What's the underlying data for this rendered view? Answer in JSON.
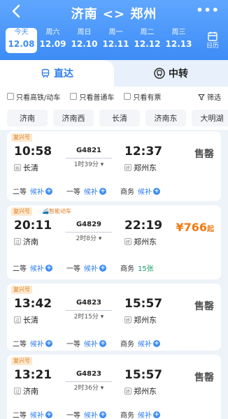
{
  "header": {
    "title": "济南 <> 郑州",
    "more": "•••",
    "calendar_label": "日历"
  },
  "dates": [
    {
      "weekday": "今天",
      "date": "12.08",
      "active": true
    },
    {
      "weekday": "周六",
      "date": "12.09",
      "active": false
    },
    {
      "weekday": "周日",
      "date": "12.10",
      "active": false
    },
    {
      "weekday": "周一",
      "date": "12.11",
      "active": false
    },
    {
      "weekday": "周二",
      "date": "12.12",
      "active": false
    },
    {
      "weekday": "周三",
      "date": "12.13",
      "active": false
    }
  ],
  "tabs": {
    "direct": "直达",
    "transfer": "中转"
  },
  "filters": {
    "gaotie": "只看高铁/动车",
    "putong": "只看普通车",
    "youpiao": "只看有票",
    "shaixuan": "筛选"
  },
  "stations": [
    "济南",
    "济南西",
    "长清",
    "济南东",
    "大明湖"
  ],
  "trains": [
    {
      "type": "复兴号",
      "smart": "",
      "dep_time": "10:58",
      "dep_station": "长清",
      "dep_tag": "始",
      "train_no": "G4821",
      "duration": "1时39分",
      "arr_time": "12:37",
      "arr_station": "郑州东",
      "arr_tag": "终",
      "status": "售罄",
      "price": "",
      "seats": [
        {
          "name": "二等",
          "value": "候补"
        },
        {
          "name": "一等",
          "value": "候补"
        },
        {
          "name": "商务",
          "value": "候补"
        }
      ]
    },
    {
      "type": "复兴号",
      "smart": "智能动车",
      "dep_time": "20:11",
      "dep_station": "济南",
      "dep_tag": "过",
      "train_no": "G4829",
      "duration": "2时8分",
      "arr_time": "22:19",
      "arr_station": "郑州东",
      "arr_tag": "终",
      "status": "",
      "price": "¥766",
      "price_suffix": "起",
      "seats": [
        {
          "name": "二等",
          "value": "候补"
        },
        {
          "name": "一等",
          "value": "候补"
        },
        {
          "name": "商务",
          "value": "15张"
        }
      ]
    },
    {
      "type": "复兴号",
      "smart": "",
      "dep_time": "13:42",
      "dep_station": "长清",
      "dep_tag": "过",
      "train_no": "G4823",
      "duration": "2时15分",
      "arr_time": "15:57",
      "arr_station": "郑州东",
      "arr_tag": "终",
      "status": "售罄",
      "price": "",
      "seats": [
        {
          "name": "二等",
          "value": "候补"
        },
        {
          "name": "一等",
          "value": "候补"
        },
        {
          "name": "商务",
          "value": "候补"
        }
      ]
    },
    {
      "type": "复兴号",
      "smart": "",
      "dep_time": "13:21",
      "dep_station": "济南",
      "dep_tag": "过",
      "train_no": "G4823",
      "duration": "2时36分",
      "arr_time": "15:57",
      "arr_station": "郑州东",
      "arr_tag": "终",
      "status": "售罄",
      "price": "",
      "seats": [
        {
          "name": "二等",
          "value": "候补"
        },
        {
          "name": "一等",
          "value": "候补"
        },
        {
          "name": "商务",
          "value": "候补"
        }
      ]
    }
  ],
  "colors": {
    "brand": "#3d8cf6",
    "price": "#f07a10",
    "available": "#19a06b"
  }
}
